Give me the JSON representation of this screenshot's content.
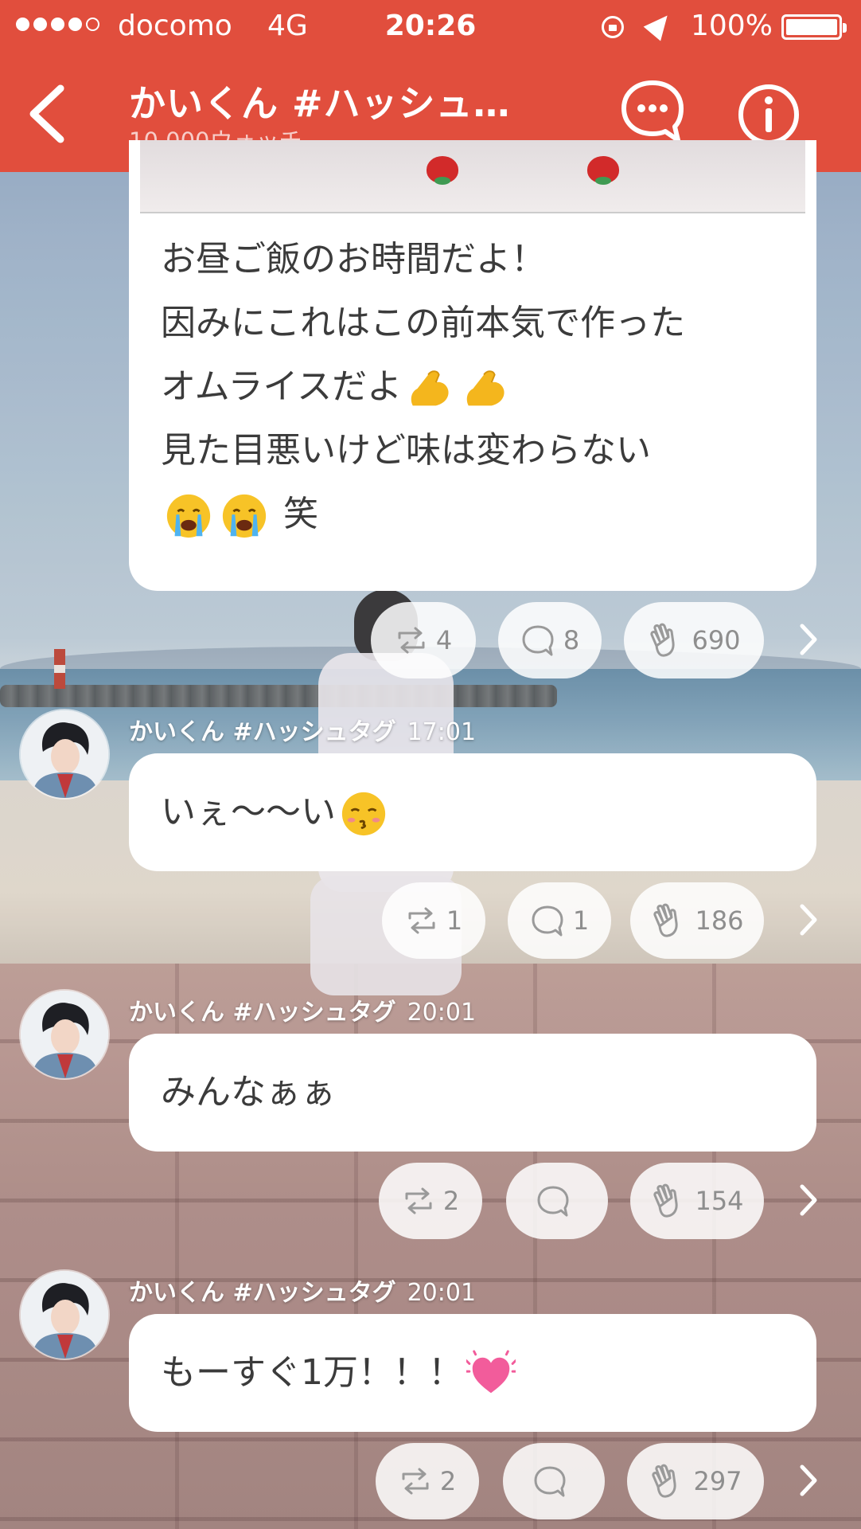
{
  "status_bar": {
    "carrier": "docomo",
    "network": "4G",
    "time": "20:26",
    "battery": "100%",
    "signal_bars_filled": 4,
    "signal_bars_total": 5
  },
  "header": {
    "title": "かいくん #ハッシュ…",
    "subtitle": "10,000ウォッチ",
    "accent_color": "#e14e3d",
    "icons": [
      "chevron-left-icon",
      "chat-bubble-icon",
      "info-icon"
    ]
  },
  "posts": [
    {
      "text_lines": [
        "お昼ご飯のお時間だよ！",
        "因みにこれはこの前本気で作った",
        "オムライスだよ",
        "見た目悪いけど味は変わらない",
        "笑"
      ],
      "emoji": [
        "flexed-biceps-icon",
        "flexed-biceps-icon",
        "crying-face-icon",
        "crying-face-icon"
      ],
      "repost_count": "4",
      "comment_count": "8",
      "clap_count": "690"
    },
    {
      "author": "かいくん #ハッシュタグ",
      "time": "17:01",
      "text": "いぇ〜〜い",
      "emoji": "kissing-face-icon",
      "repost_count": "1",
      "comment_count": "1",
      "clap_count": "186"
    },
    {
      "author": "かいくん #ハッシュタグ",
      "time": "20:01",
      "text": "みんなぁぁ",
      "repost_count": "2",
      "comment_count": "",
      "clap_count": "154"
    },
    {
      "author": "かいくん #ハッシュタグ",
      "time": "20:01",
      "text": "もーすぐ1万！！！",
      "emoji": "beating-heart-icon",
      "repost_count": "2",
      "comment_count": "",
      "clap_count": "297"
    }
  ]
}
